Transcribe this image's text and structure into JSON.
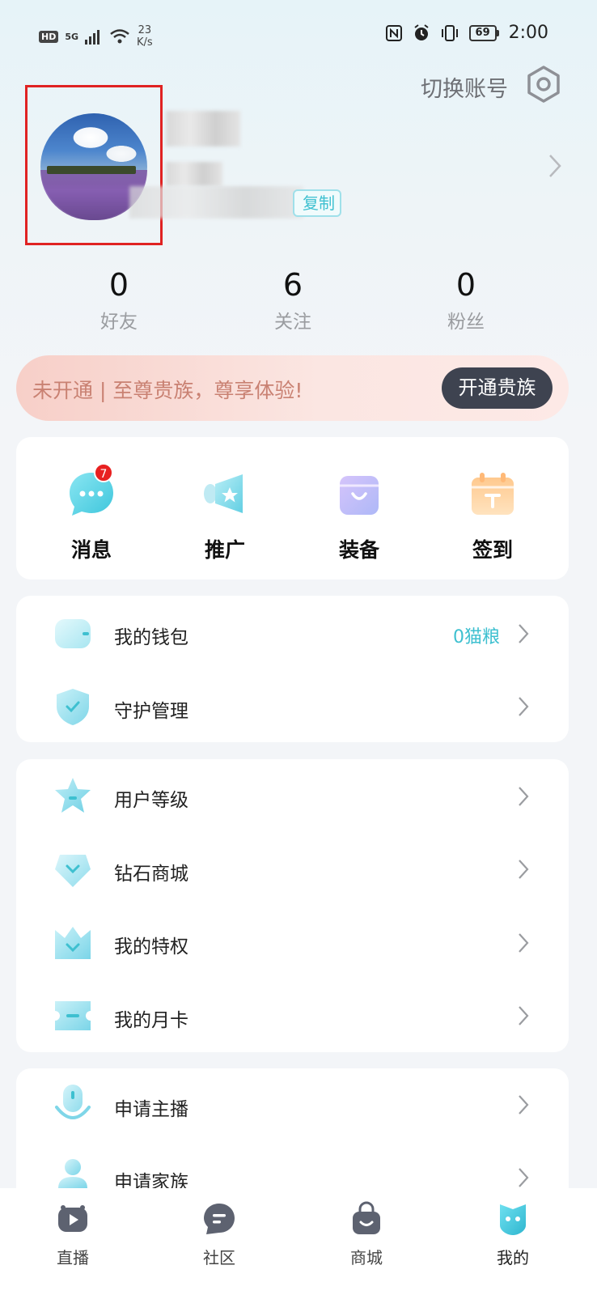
{
  "status_bar": {
    "hd": "HD",
    "network": "5G",
    "speed_value": "23",
    "speed_unit": "K/s",
    "battery": "69",
    "time": "2:00"
  },
  "header": {
    "switch_account": "切换账号",
    "copy_label": "复制"
  },
  "stats": [
    {
      "value": "0",
      "label": "好友"
    },
    {
      "value": "6",
      "label": "关注"
    },
    {
      "value": "0",
      "label": "粉丝"
    }
  ],
  "vip": {
    "text": "未开通 | 至尊贵族，尊享体验!",
    "button": "开通贵族"
  },
  "quick_actions": [
    {
      "label": "消息",
      "icon": "message-icon",
      "badge": "7"
    },
    {
      "label": "推广",
      "icon": "promote-icon"
    },
    {
      "label": "装备",
      "icon": "equipment-icon"
    },
    {
      "label": "签到",
      "icon": "checkin-icon"
    }
  ],
  "menu_group_1": [
    {
      "label": "我的钱包",
      "icon": "wallet-icon",
      "value": "0猫粮"
    },
    {
      "label": "守护管理",
      "icon": "shield-icon"
    }
  ],
  "menu_group_2": [
    {
      "label": "用户等级",
      "icon": "star-icon"
    },
    {
      "label": "钻石商城",
      "icon": "diamond-icon"
    },
    {
      "label": "我的特权",
      "icon": "crown-icon"
    },
    {
      "label": "我的月卡",
      "icon": "ticket-icon"
    }
  ],
  "menu_group_3": [
    {
      "label": "申请主播",
      "icon": "microphone-icon"
    },
    {
      "label": "申请家族",
      "icon": "person-icon"
    }
  ],
  "tabs": [
    {
      "label": "直播",
      "icon": "live-icon"
    },
    {
      "label": "社区",
      "icon": "community-icon"
    },
    {
      "label": "商城",
      "icon": "shop-icon"
    },
    {
      "label": "我的",
      "icon": "profile-icon",
      "active": true
    }
  ],
  "colors": {
    "accent": "#3ec0d0",
    "vip_text": "#c98172",
    "vip_button": "#3e4350",
    "badge": "#e82020",
    "highlight_frame": "#e02222"
  }
}
